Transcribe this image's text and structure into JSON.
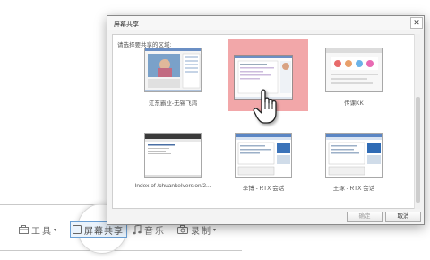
{
  "dialog": {
    "title": "屏幕共享",
    "close_glyph": "✕",
    "prompt": "请选择要共享的区域:",
    "windows": [
      {
        "label": "江东霸业-无锡飞鸿",
        "selected": false
      },
      {
        "label": "",
        "selected": true
      },
      {
        "label": "传课KK",
        "selected": false
      },
      {
        "label": "Index of /chuankeIversion/2...",
        "selected": false
      },
      {
        "label": "李博 - RTX 会话",
        "selected": false
      },
      {
        "label": "王琢 - RTX 会话",
        "selected": false
      }
    ],
    "ok_label": "确定",
    "cancel_label": "取消",
    "selected_color": "#f2a7a9"
  },
  "toolbar": {
    "tools_label": "工具",
    "share_label": "屏幕共享",
    "music_label": "音乐",
    "record_label": "录制",
    "arrow_glyph": "▾"
  },
  "icons": {
    "tools": "toolbox-icon",
    "share": "screen-share-icon",
    "music": "music-note-icon",
    "record": "camera-icon",
    "cursor": "hand-pointer-icon"
  }
}
